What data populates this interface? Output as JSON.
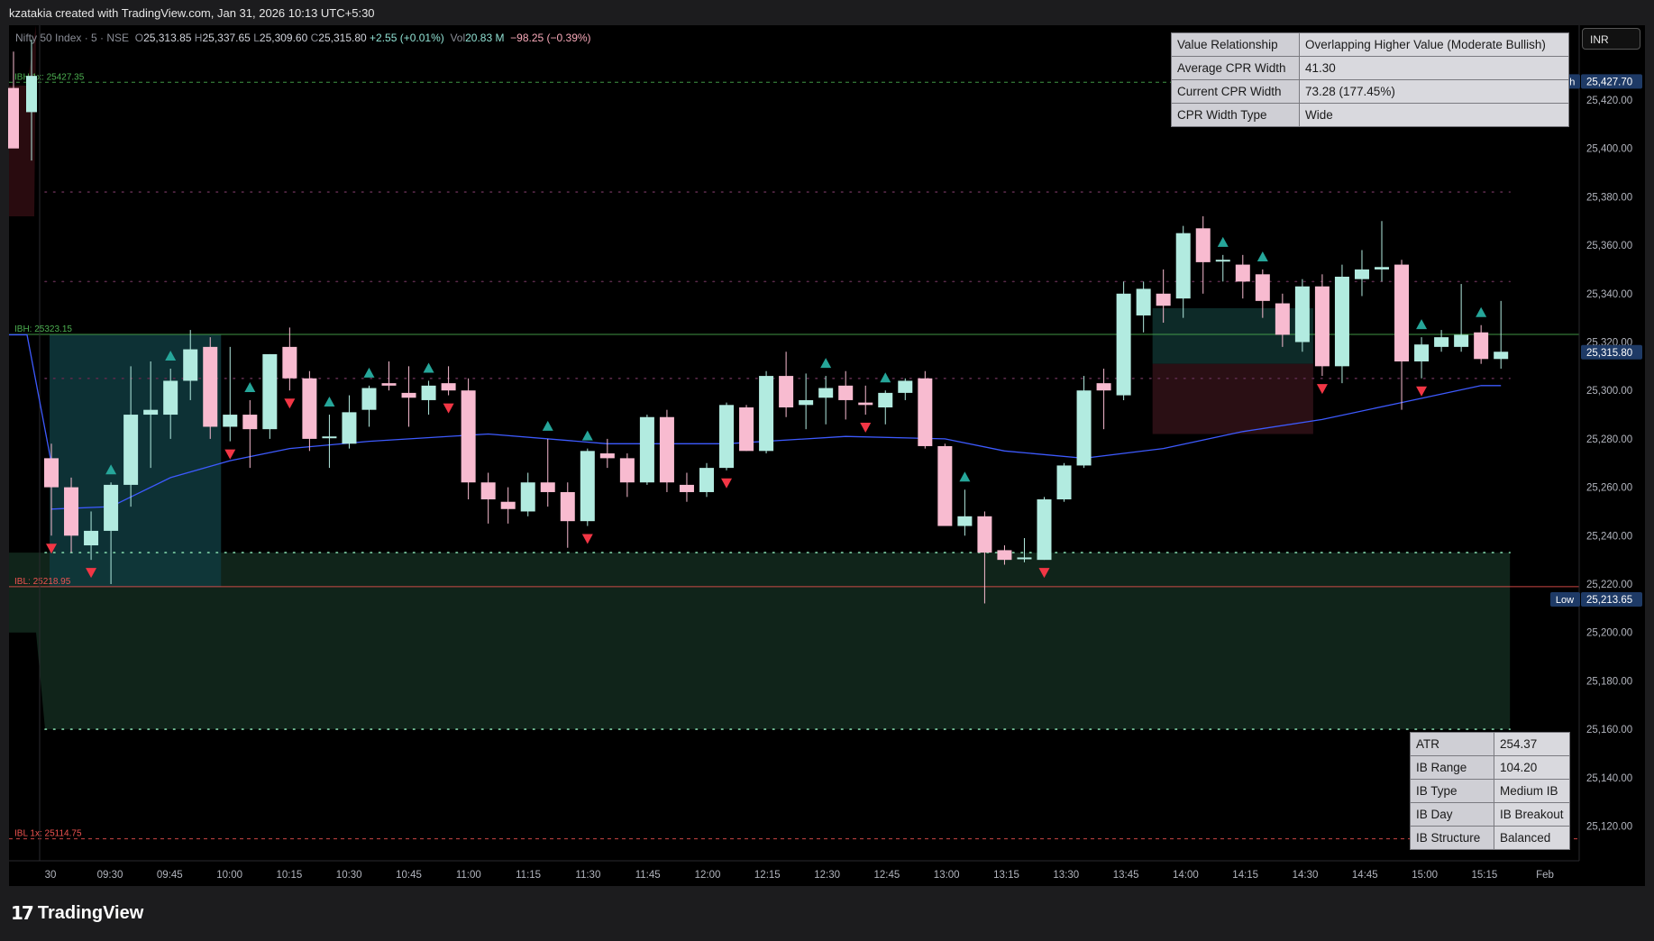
{
  "header": {
    "credit": "kzatakia created with TradingView.com, Jan 31, 2026 10:13 UTC+5:30"
  },
  "legend": {
    "symbol": "Nifty 50 Index · 5 · NSE",
    "o_label": "O",
    "o": "25,313.85",
    "h_label": "H",
    "h": "25,337.65",
    "l_label": "L",
    "l": "25,309.60",
    "c_label": "C",
    "c": "25,315.80",
    "change": "+2.55 (+0.01%)",
    "vol_label": "Vol",
    "vol": "20.83 M",
    "vol_change": "−98.25 (−0.39%)"
  },
  "currency": "INR",
  "brand": {
    "logo": "17",
    "name": "TradingView"
  },
  "colors": {
    "up": "#b2ebe0",
    "down": "#f8bbd0",
    "ma": "#3d5afe",
    "ib_box": "#0f3a3e",
    "value_zone": "#10241a",
    "ibh": "#4caf50",
    "ibl": "#ef5350",
    "signal_up": "#26a69a",
    "signal_down": "#f23645"
  },
  "cpr_table": [
    {
      "key": "Value Relationship",
      "value": "Overlapping Higher Value (Moderate Bullish)"
    },
    {
      "key": "Average CPR Width",
      "value": "41.30"
    },
    {
      "key": "Current CPR Width",
      "value": "73.28 (177.45%)"
    },
    {
      "key": "CPR Width Type",
      "value": "Wide"
    }
  ],
  "ib_table": [
    {
      "key": "ATR",
      "value": "254.37"
    },
    {
      "key": "IB Range",
      "value": "104.20"
    },
    {
      "key": "IB Type",
      "value": "Medium IB"
    },
    {
      "key": "IB Day",
      "value": "IB Breakout"
    },
    {
      "key": "IB Structure",
      "value": "Balanced"
    }
  ],
  "chart_data": {
    "type": "candlestick",
    "x_tick_labels": [
      "30",
      "09:30",
      "09:45",
      "10:00",
      "10:15",
      "10:30",
      "10:45",
      "11:00",
      "11:15",
      "11:30",
      "11:45",
      "12:00",
      "12:15",
      "12:30",
      "12:45",
      "13:00",
      "13:15",
      "13:30",
      "13:45",
      "14:00",
      "14:15",
      "14:30",
      "14:45",
      "15:00",
      "15:15",
      "Feb"
    ],
    "y_ticks": [
      25120,
      25140,
      25160,
      25180,
      25200,
      25220,
      25240,
      25260,
      25280,
      25300,
      25320,
      25340,
      25360,
      25380,
      25400,
      25420
    ],
    "y_tick_labels": [
      "25,120.00",
      "25,140.00",
      "25,160.00",
      "25,180.00",
      "25,200.00",
      "25,220.00",
      "25,240.00",
      "25,260.00",
      "25,280.00",
      "25,300.00",
      "25,320.00",
      "25,340.00",
      "25,360.00",
      "25,380.00",
      "25,400.00",
      "25,420.00"
    ],
    "ylim": [
      25100,
      25445
    ],
    "price_badges": [
      {
        "label": "High",
        "price": 25427.7,
        "text": "25,427.70"
      },
      {
        "label": "",
        "price": 25315.8,
        "text": "25,315.80"
      },
      {
        "label": "Low",
        "price": 25213.65,
        "text": "25,213.65"
      }
    ],
    "levels": [
      {
        "name": "IBH 1x",
        "price": 25427.35,
        "label": "IBH 1x: 25427.35",
        "style": "dashed",
        "color": "#4caf50"
      },
      {
        "name": "IBH",
        "price": 25323.15,
        "label": "IBH: 25323.15",
        "style": "solid",
        "color": "#4caf50"
      },
      {
        "name": "IBL",
        "price": 25218.95,
        "label": "IBL: 25218.95",
        "style": "solid",
        "color": "#ef5350"
      },
      {
        "name": "IBL 1x",
        "price": 25114.75,
        "label": "IBL 1x: 25114.75",
        "style": "dashed",
        "color": "#ef5350"
      }
    ],
    "dotted_levels": [
      25382,
      25345,
      25305,
      25233,
      25160
    ],
    "value_zone": {
      "top": 25233,
      "bottom": 25160
    },
    "ib_box": {
      "top": 25323.15,
      "bottom": 25218.95,
      "from_index": 0,
      "to_index": 8
    },
    "candles": [
      {
        "o": 25272,
        "h": 25278,
        "l": 25240,
        "c": 25260
      },
      {
        "o": 25260,
        "h": 25264,
        "l": 25233,
        "c": 25240
      },
      {
        "o": 25236,
        "h": 25250,
        "l": 25230,
        "c": 25242
      },
      {
        "o": 25242,
        "h": 25262,
        "l": 25220,
        "c": 25261
      },
      {
        "o": 25261,
        "h": 25310,
        "l": 25252,
        "c": 25290
      },
      {
        "o": 25290,
        "h": 25312,
        "l": 25268,
        "c": 25292
      },
      {
        "o": 25290,
        "h": 25309,
        "l": 25280,
        "c": 25304
      },
      {
        "o": 25304,
        "h": 25325,
        "l": 25296,
        "c": 25317
      },
      {
        "o": 25318,
        "h": 25322,
        "l": 25280,
        "c": 25285
      },
      {
        "o": 25285,
        "h": 25318,
        "l": 25279,
        "c": 25290
      },
      {
        "o": 25290,
        "h": 25296,
        "l": 25268,
        "c": 25284
      },
      {
        "o": 25284,
        "h": 25315,
        "l": 25280,
        "c": 25315
      },
      {
        "o": 25318,
        "h": 25326,
        "l": 25300,
        "c": 25305
      },
      {
        "o": 25305,
        "h": 25308,
        "l": 25275,
        "c": 25280
      },
      {
        "o": 25281,
        "h": 25290,
        "l": 25268,
        "c": 25281
      },
      {
        "o": 25278,
        "h": 25298,
        "l": 25276,
        "c": 25291
      },
      {
        "o": 25292,
        "h": 25302,
        "l": 25285,
        "c": 25301
      },
      {
        "o": 25303,
        "h": 25312,
        "l": 25300,
        "c": 25302
      },
      {
        "o": 25299,
        "h": 25310,
        "l": 25285,
        "c": 25297
      },
      {
        "o": 25296,
        "h": 25304,
        "l": 25290,
        "c": 25302
      },
      {
        "o": 25303,
        "h": 25310,
        "l": 25298,
        "c": 25300
      },
      {
        "o": 25300,
        "h": 25305,
        "l": 25255,
        "c": 25262
      },
      {
        "o": 25262,
        "h": 25266,
        "l": 25245,
        "c": 25255
      },
      {
        "o": 25254,
        "h": 25260,
        "l": 25245,
        "c": 25251
      },
      {
        "o": 25250,
        "h": 25266,
        "l": 25248,
        "c": 25262
      },
      {
        "o": 25262,
        "h": 25280,
        "l": 25252,
        "c": 25258
      },
      {
        "o": 25258,
        "h": 25262,
        "l": 25235,
        "c": 25246
      },
      {
        "o": 25246,
        "h": 25276,
        "l": 25244,
        "c": 25275
      },
      {
        "o": 25274,
        "h": 25280,
        "l": 25268,
        "c": 25272
      },
      {
        "o": 25272,
        "h": 25274,
        "l": 25256,
        "c": 25262
      },
      {
        "o": 25262,
        "h": 25290,
        "l": 25261,
        "c": 25289
      },
      {
        "o": 25289,
        "h": 25292,
        "l": 25258,
        "c": 25262
      },
      {
        "o": 25261,
        "h": 25266,
        "l": 25254,
        "c": 25258
      },
      {
        "o": 25258,
        "h": 25270,
        "l": 25256,
        "c": 25268
      },
      {
        "o": 25268,
        "h": 25295,
        "l": 25267,
        "c": 25294
      },
      {
        "o": 25293,
        "h": 25294,
        "l": 25275,
        "c": 25275
      },
      {
        "o": 25275,
        "h": 25308,
        "l": 25274,
        "c": 25306
      },
      {
        "o": 25306,
        "h": 25316,
        "l": 25289,
        "c": 25293
      },
      {
        "o": 25294,
        "h": 25307,
        "l": 25284,
        "c": 25296
      },
      {
        "o": 25297,
        "h": 25306,
        "l": 25286,
        "c": 25301
      },
      {
        "o": 25302,
        "h": 25308,
        "l": 25288,
        "c": 25296
      },
      {
        "o": 25295,
        "h": 25302,
        "l": 25290,
        "c": 25294
      },
      {
        "o": 25293,
        "h": 25300,
        "l": 25286,
        "c": 25299
      },
      {
        "o": 25299,
        "h": 25305,
        "l": 25296,
        "c": 25304
      },
      {
        "o": 25305,
        "h": 25308,
        "l": 25276,
        "c": 25277
      },
      {
        "o": 25277,
        "h": 25278,
        "l": 25245,
        "c": 25244
      },
      {
        "o": 25244,
        "h": 25259,
        "l": 25240,
        "c": 25248
      },
      {
        "o": 25248,
        "h": 25250,
        "l": 25212,
        "c": 25233
      },
      {
        "o": 25234,
        "h": 25236,
        "l": 25228,
        "c": 25230
      },
      {
        "o": 25231,
        "h": 25239,
        "l": 25229,
        "c": 25231
      },
      {
        "o": 25230,
        "h": 25256,
        "l": 25230,
        "c": 25255
      },
      {
        "o": 25255,
        "h": 25270,
        "l": 25254,
        "c": 25269
      },
      {
        "o": 25269,
        "h": 25306,
        "l": 25268,
        "c": 25300
      },
      {
        "o": 25303,
        "h": 25309,
        "l": 25284,
        "c": 25300
      },
      {
        "o": 25298,
        "h": 25345,
        "l": 25296,
        "c": 25340
      },
      {
        "o": 25331,
        "h": 25345,
        "l": 25324,
        "c": 25342
      },
      {
        "o": 25340,
        "h": 25350,
        "l": 25328,
        "c": 25335
      },
      {
        "o": 25338,
        "h": 25368,
        "l": 25330,
        "c": 25365
      },
      {
        "o": 25367,
        "h": 25372,
        "l": 25340,
        "c": 25353
      },
      {
        "o": 25354,
        "h": 25356,
        "l": 25345,
        "c": 25354
      },
      {
        "o": 25352,
        "h": 25356,
        "l": 25338,
        "c": 25345
      },
      {
        "o": 25348,
        "h": 25350,
        "l": 25330,
        "c": 25337
      },
      {
        "o": 25336,
        "h": 25340,
        "l": 25318,
        "c": 25323
      },
      {
        "o": 25320,
        "h": 25346,
        "l": 25316,
        "c": 25343
      },
      {
        "o": 25343,
        "h": 25348,
        "l": 25306,
        "c": 25310
      },
      {
        "o": 25310,
        "h": 25352,
        "l": 25303,
        "c": 25347
      },
      {
        "o": 25346,
        "h": 25358,
        "l": 25339,
        "c": 25350
      },
      {
        "o": 25350,
        "h": 25370,
        "l": 25345,
        "c": 25351
      },
      {
        "o": 25352,
        "h": 25354,
        "l": 25292,
        "c": 25312
      },
      {
        "o": 25312,
        "h": 25322,
        "l": 25305,
        "c": 25319
      },
      {
        "o": 25318,
        "h": 25325,
        "l": 25316,
        "c": 25322
      },
      {
        "o": 25318,
        "h": 25344,
        "l": 25316,
        "c": 25323
      },
      {
        "o": 25324,
        "h": 25327,
        "l": 25311,
        "c": 25313
      },
      {
        "o": 25313,
        "h": 25337,
        "l": 25309,
        "c": 25316
      }
    ],
    "moving_average": [
      {
        "i": 0,
        "v": 25251
      },
      {
        "i": 3,
        "v": 25252
      },
      {
        "i": 6,
        "v": 25264
      },
      {
        "i": 9,
        "v": 25271
      },
      {
        "i": 12,
        "v": 25276
      },
      {
        "i": 16,
        "v": 25279
      },
      {
        "i": 22,
        "v": 25282
      },
      {
        "i": 28,
        "v": 25278
      },
      {
        "i": 34,
        "v": 25278
      },
      {
        "i": 40,
        "v": 25281
      },
      {
        "i": 45,
        "v": 25280
      },
      {
        "i": 48,
        "v": 25275
      },
      {
        "i": 52,
        "v": 25272
      },
      {
        "i": 56,
        "v": 25276
      },
      {
        "i": 60,
        "v": 25283
      },
      {
        "i": 64,
        "v": 25288
      },
      {
        "i": 68,
        "v": 25295
      },
      {
        "i": 72,
        "v": 25302
      },
      {
        "i": 73,
        "v": 25302
      }
    ],
    "left_moving_average": [
      {
        "v": 25323
      },
      {
        "v": 25323
      },
      {
        "v": 25270
      }
    ],
    "signals_up": [
      3,
      6,
      10,
      14,
      16,
      19,
      25,
      27,
      39,
      42,
      46,
      59,
      61,
      69,
      72
    ],
    "signals_down": [
      0,
      2,
      9,
      12,
      20,
      27,
      34,
      41,
      50,
      64,
      69
    ],
    "highlight_boxes": [
      {
        "from_index": 56,
        "to_index": 63,
        "top": 25334,
        "bottom": 25311,
        "color": "#0d2a28"
      },
      {
        "from_index": 56,
        "to_index": 63,
        "top": 25311,
        "bottom": 25282,
        "color": "#2a0f14"
      }
    ]
  }
}
